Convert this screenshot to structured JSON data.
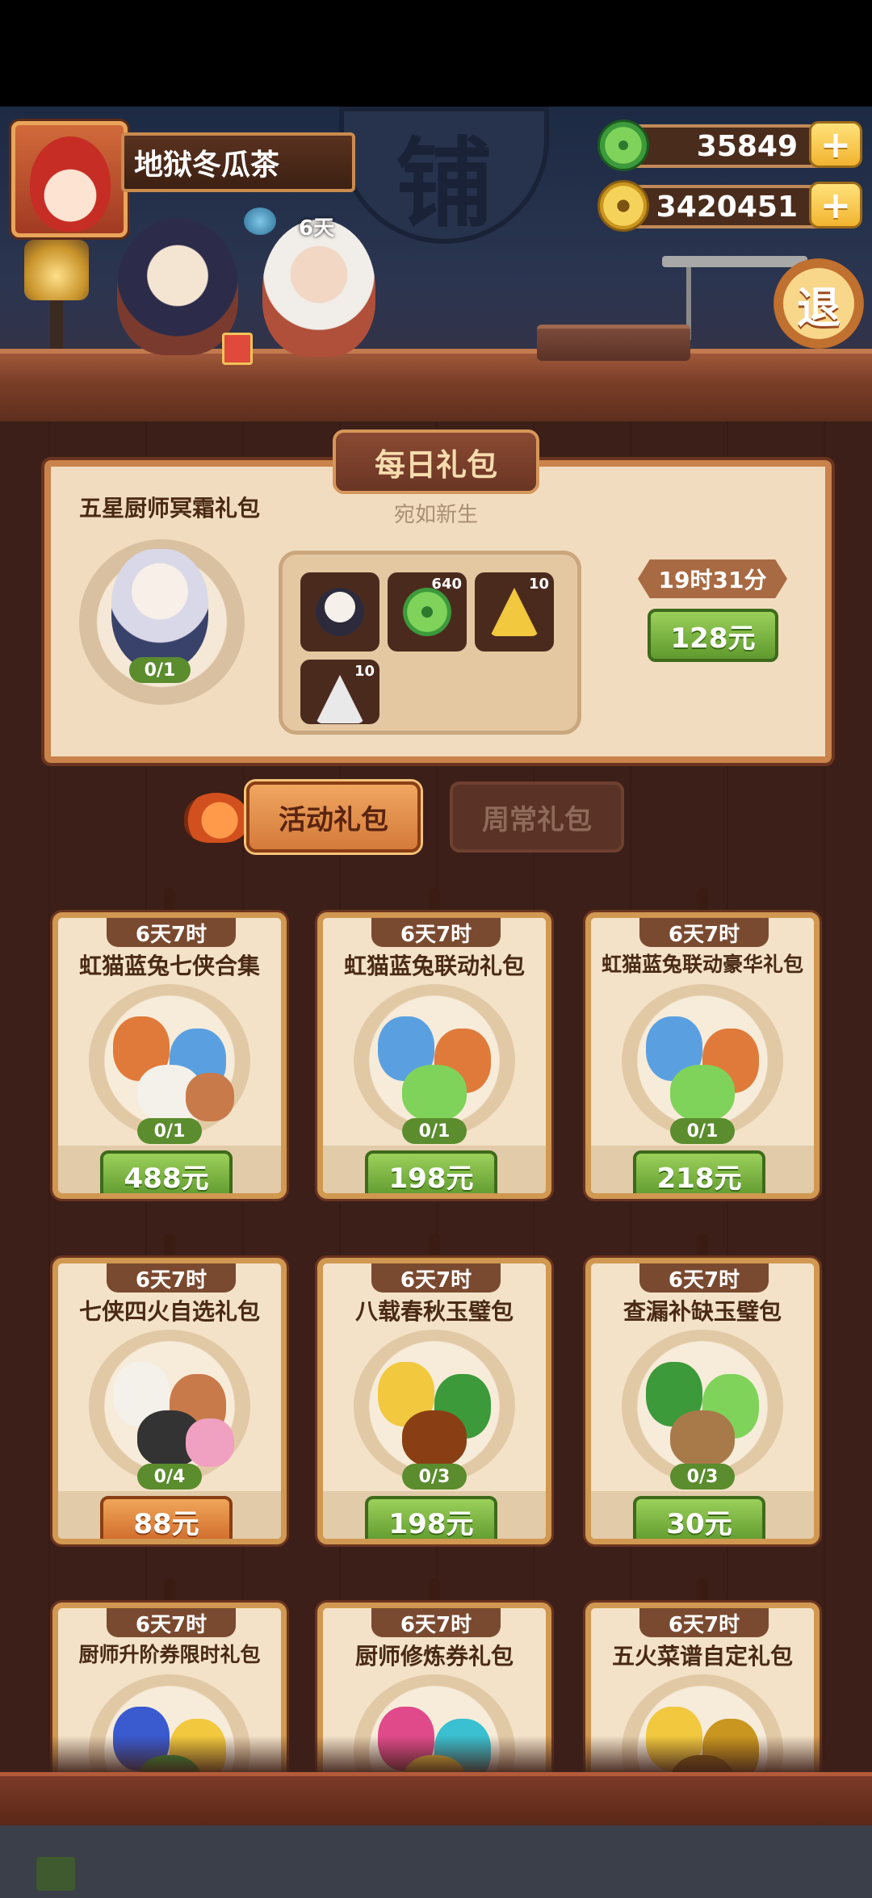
{
  "player": {
    "name": "地狱冬瓜茶"
  },
  "currency": {
    "jade": "35849",
    "coins": "3420451"
  },
  "scene": {
    "shop_sign": "铺",
    "days_tag": "6天",
    "exit_label": "退"
  },
  "daily_pack": {
    "title": "每日礼包",
    "subtitle": "宛如新生",
    "name": "五星厨师冥霜礼包",
    "count": "0/1",
    "timer": "19时31分",
    "price": "128元",
    "items": [
      {
        "icon": "chef-card-icon",
        "qty": ""
      },
      {
        "icon": "jade-icon",
        "qty": "640"
      },
      {
        "icon": "gold-rice-dumpling-icon",
        "qty": "10"
      },
      {
        "icon": "silver-rice-dumpling-icon",
        "qty": "10"
      }
    ]
  },
  "tabs": {
    "active": "活动礼包",
    "inactive": "周常礼包"
  },
  "packs": [
    {
      "timer": "6天7时",
      "name": "虹猫蓝兔七侠合集",
      "count": "0/1",
      "price": "488元",
      "button": "green"
    },
    {
      "timer": "6天7时",
      "name": "虹猫蓝兔联动礼包",
      "count": "0/1",
      "price": "198元",
      "button": "green"
    },
    {
      "timer": "6天7时",
      "name": "虹猫蓝兔联动豪华礼包",
      "count": "0/1",
      "price": "218元",
      "button": "green"
    },
    {
      "timer": "6天7时",
      "name": "七侠四火自选礼包",
      "count": "0/4",
      "price": "88元",
      "button": "orange"
    },
    {
      "timer": "6天7时",
      "name": "八载春秋玉璧包",
      "count": "0/3",
      "price": "198元",
      "button": "green"
    },
    {
      "timer": "6天7时",
      "name": "查漏补缺玉璧包",
      "count": "0/3",
      "price": "30元",
      "button": "green"
    },
    {
      "timer": "6天7时",
      "name": "厨师升阶券限时礼包",
      "count": "",
      "price": "",
      "button": "green"
    },
    {
      "timer": "6天7时",
      "name": "厨师修炼券礼包",
      "count": "",
      "price": "",
      "button": "green"
    },
    {
      "timer": "6天7时",
      "name": "五火菜谱自定礼包",
      "count": "",
      "price": "",
      "button": "green"
    }
  ],
  "colors": {
    "accent_green": "#5f9a2e",
    "accent_orange": "#d47a3a",
    "wood": "#3c1f18"
  }
}
